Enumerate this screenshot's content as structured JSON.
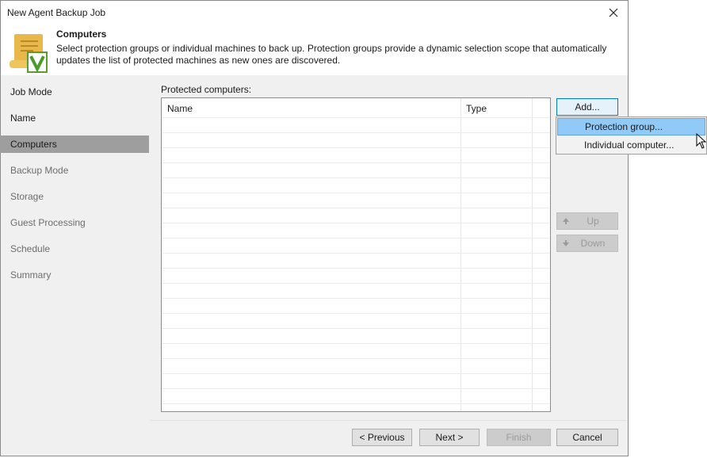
{
  "window": {
    "title": "New Agent Backup Job"
  },
  "header": {
    "icon": "scroll-v-icon",
    "title": "Computers",
    "description": "Select protection groups or individual machines to back up. Protection groups provide a dynamic selection scope that automatically updates the list of protected machines as new ones are discovered."
  },
  "sidebar": {
    "items": [
      {
        "label": "Job Mode",
        "state": "normal"
      },
      {
        "label": "Name",
        "state": "normal"
      },
      {
        "label": "Computers",
        "state": "active"
      },
      {
        "label": "Backup Mode",
        "state": "disabled"
      },
      {
        "label": "Storage",
        "state": "disabled"
      },
      {
        "label": "Guest Processing",
        "state": "disabled"
      },
      {
        "label": "Schedule",
        "state": "disabled"
      },
      {
        "label": "Summary",
        "state": "disabled"
      }
    ]
  },
  "main": {
    "list_label": "Protected computers:",
    "columns": [
      "Name",
      "Type"
    ],
    "rows": []
  },
  "buttons": {
    "add": "Add...",
    "up": "Up",
    "down": "Down"
  },
  "add_menu": {
    "items": [
      "Protection group...",
      "Individual computer..."
    ]
  },
  "footer": {
    "previous": "< Previous",
    "next": "Next >",
    "finish": "Finish",
    "cancel": "Cancel"
  },
  "colors": {
    "active_nav": "#9e9e9e",
    "menu_highlight": "#91c9f7",
    "focus_border": "#0078d7"
  }
}
